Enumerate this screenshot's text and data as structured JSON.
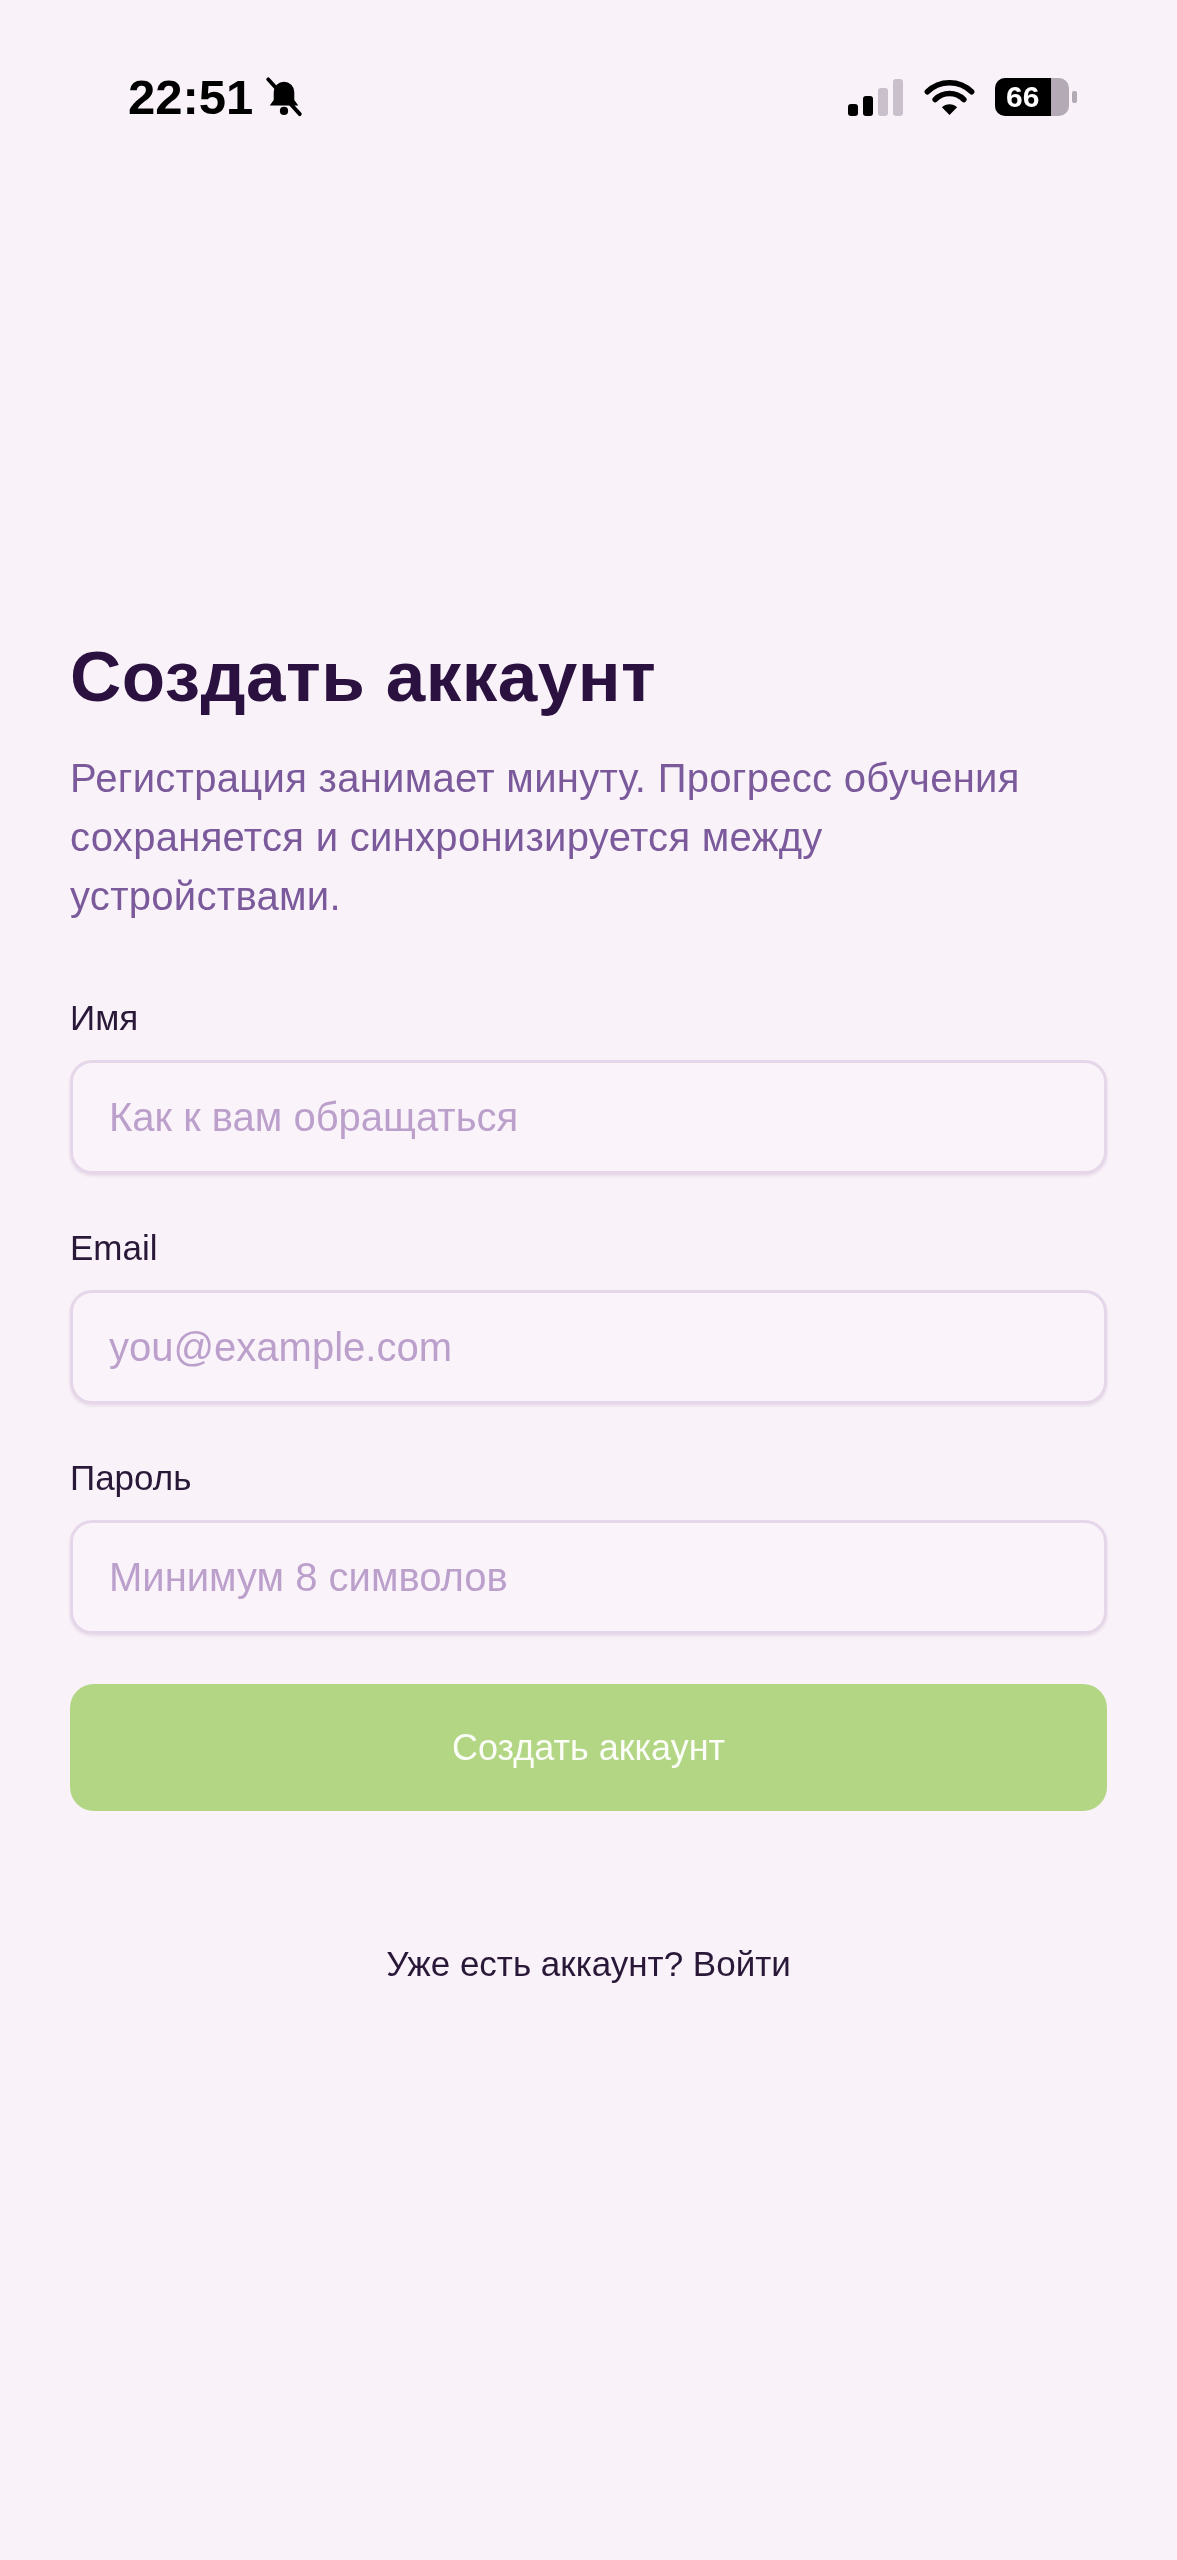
{
  "status_bar": {
    "time": "22:51",
    "battery": "66"
  },
  "title": "Создать аккаунт",
  "subtitle": "Регистрация занимает минуту. Прогресс обучения сохраняется и синхронизируется между устройствами.",
  "fields": [
    {
      "label": "Имя",
      "placeholder": "Как к вам обращаться"
    },
    {
      "label": "Email",
      "placeholder": "you@example.com"
    },
    {
      "label": "Пароль",
      "placeholder": "Минимум 8 символов"
    }
  ],
  "submit_button": {
    "label": "Создать аккаунт",
    "disabled": true
  },
  "signin_link": "Уже есть аккаунт? Войти"
}
